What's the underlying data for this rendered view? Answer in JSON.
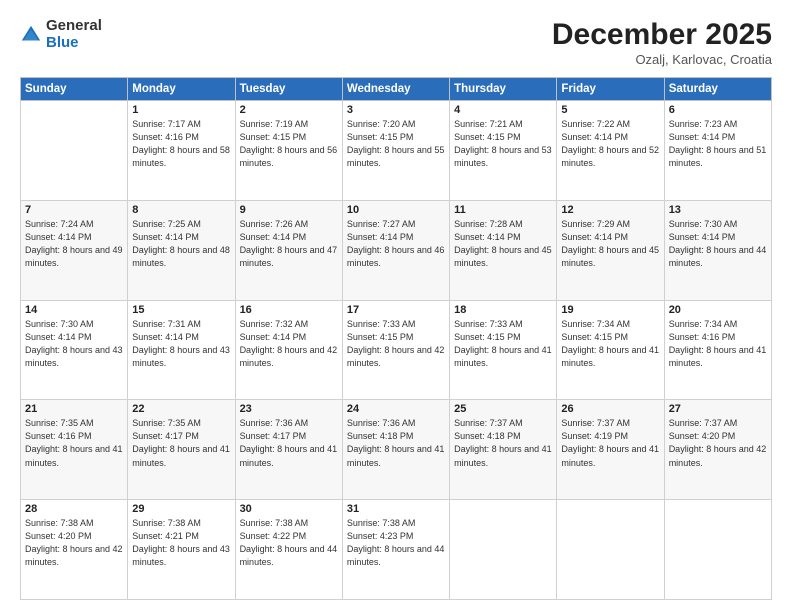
{
  "logo": {
    "general": "General",
    "blue": "Blue"
  },
  "header": {
    "month": "December 2025",
    "location": "Ozalj, Karlovac, Croatia"
  },
  "weekdays": [
    "Sunday",
    "Monday",
    "Tuesday",
    "Wednesday",
    "Thursday",
    "Friday",
    "Saturday"
  ],
  "weeks": [
    [
      {
        "day": "",
        "sunrise": "",
        "sunset": "",
        "daylight": ""
      },
      {
        "day": "1",
        "sunrise": "Sunrise: 7:17 AM",
        "sunset": "Sunset: 4:16 PM",
        "daylight": "Daylight: 8 hours and 58 minutes."
      },
      {
        "day": "2",
        "sunrise": "Sunrise: 7:19 AM",
        "sunset": "Sunset: 4:15 PM",
        "daylight": "Daylight: 8 hours and 56 minutes."
      },
      {
        "day": "3",
        "sunrise": "Sunrise: 7:20 AM",
        "sunset": "Sunset: 4:15 PM",
        "daylight": "Daylight: 8 hours and 55 minutes."
      },
      {
        "day": "4",
        "sunrise": "Sunrise: 7:21 AM",
        "sunset": "Sunset: 4:15 PM",
        "daylight": "Daylight: 8 hours and 53 minutes."
      },
      {
        "day": "5",
        "sunrise": "Sunrise: 7:22 AM",
        "sunset": "Sunset: 4:14 PM",
        "daylight": "Daylight: 8 hours and 52 minutes."
      },
      {
        "day": "6",
        "sunrise": "Sunrise: 7:23 AM",
        "sunset": "Sunset: 4:14 PM",
        "daylight": "Daylight: 8 hours and 51 minutes."
      }
    ],
    [
      {
        "day": "7",
        "sunrise": "Sunrise: 7:24 AM",
        "sunset": "Sunset: 4:14 PM",
        "daylight": "Daylight: 8 hours and 49 minutes."
      },
      {
        "day": "8",
        "sunrise": "Sunrise: 7:25 AM",
        "sunset": "Sunset: 4:14 PM",
        "daylight": "Daylight: 8 hours and 48 minutes."
      },
      {
        "day": "9",
        "sunrise": "Sunrise: 7:26 AM",
        "sunset": "Sunset: 4:14 PM",
        "daylight": "Daylight: 8 hours and 47 minutes."
      },
      {
        "day": "10",
        "sunrise": "Sunrise: 7:27 AM",
        "sunset": "Sunset: 4:14 PM",
        "daylight": "Daylight: 8 hours and 46 minutes."
      },
      {
        "day": "11",
        "sunrise": "Sunrise: 7:28 AM",
        "sunset": "Sunset: 4:14 PM",
        "daylight": "Daylight: 8 hours and 45 minutes."
      },
      {
        "day": "12",
        "sunrise": "Sunrise: 7:29 AM",
        "sunset": "Sunset: 4:14 PM",
        "daylight": "Daylight: 8 hours and 45 minutes."
      },
      {
        "day": "13",
        "sunrise": "Sunrise: 7:30 AM",
        "sunset": "Sunset: 4:14 PM",
        "daylight": "Daylight: 8 hours and 44 minutes."
      }
    ],
    [
      {
        "day": "14",
        "sunrise": "Sunrise: 7:30 AM",
        "sunset": "Sunset: 4:14 PM",
        "daylight": "Daylight: 8 hours and 43 minutes."
      },
      {
        "day": "15",
        "sunrise": "Sunrise: 7:31 AM",
        "sunset": "Sunset: 4:14 PM",
        "daylight": "Daylight: 8 hours and 43 minutes."
      },
      {
        "day": "16",
        "sunrise": "Sunrise: 7:32 AM",
        "sunset": "Sunset: 4:14 PM",
        "daylight": "Daylight: 8 hours and 42 minutes."
      },
      {
        "day": "17",
        "sunrise": "Sunrise: 7:33 AM",
        "sunset": "Sunset: 4:15 PM",
        "daylight": "Daylight: 8 hours and 42 minutes."
      },
      {
        "day": "18",
        "sunrise": "Sunrise: 7:33 AM",
        "sunset": "Sunset: 4:15 PM",
        "daylight": "Daylight: 8 hours and 41 minutes."
      },
      {
        "day": "19",
        "sunrise": "Sunrise: 7:34 AM",
        "sunset": "Sunset: 4:15 PM",
        "daylight": "Daylight: 8 hours and 41 minutes."
      },
      {
        "day": "20",
        "sunrise": "Sunrise: 7:34 AM",
        "sunset": "Sunset: 4:16 PM",
        "daylight": "Daylight: 8 hours and 41 minutes."
      }
    ],
    [
      {
        "day": "21",
        "sunrise": "Sunrise: 7:35 AM",
        "sunset": "Sunset: 4:16 PM",
        "daylight": "Daylight: 8 hours and 41 minutes."
      },
      {
        "day": "22",
        "sunrise": "Sunrise: 7:35 AM",
        "sunset": "Sunset: 4:17 PM",
        "daylight": "Daylight: 8 hours and 41 minutes."
      },
      {
        "day": "23",
        "sunrise": "Sunrise: 7:36 AM",
        "sunset": "Sunset: 4:17 PM",
        "daylight": "Daylight: 8 hours and 41 minutes."
      },
      {
        "day": "24",
        "sunrise": "Sunrise: 7:36 AM",
        "sunset": "Sunset: 4:18 PM",
        "daylight": "Daylight: 8 hours and 41 minutes."
      },
      {
        "day": "25",
        "sunrise": "Sunrise: 7:37 AM",
        "sunset": "Sunset: 4:18 PM",
        "daylight": "Daylight: 8 hours and 41 minutes."
      },
      {
        "day": "26",
        "sunrise": "Sunrise: 7:37 AM",
        "sunset": "Sunset: 4:19 PM",
        "daylight": "Daylight: 8 hours and 41 minutes."
      },
      {
        "day": "27",
        "sunrise": "Sunrise: 7:37 AM",
        "sunset": "Sunset: 4:20 PM",
        "daylight": "Daylight: 8 hours and 42 minutes."
      }
    ],
    [
      {
        "day": "28",
        "sunrise": "Sunrise: 7:38 AM",
        "sunset": "Sunset: 4:20 PM",
        "daylight": "Daylight: 8 hours and 42 minutes."
      },
      {
        "day": "29",
        "sunrise": "Sunrise: 7:38 AM",
        "sunset": "Sunset: 4:21 PM",
        "daylight": "Daylight: 8 hours and 43 minutes."
      },
      {
        "day": "30",
        "sunrise": "Sunrise: 7:38 AM",
        "sunset": "Sunset: 4:22 PM",
        "daylight": "Daylight: 8 hours and 44 minutes."
      },
      {
        "day": "31",
        "sunrise": "Sunrise: 7:38 AM",
        "sunset": "Sunset: 4:23 PM",
        "daylight": "Daylight: 8 hours and 44 minutes."
      },
      {
        "day": "",
        "sunrise": "",
        "sunset": "",
        "daylight": ""
      },
      {
        "day": "",
        "sunrise": "",
        "sunset": "",
        "daylight": ""
      },
      {
        "day": "",
        "sunrise": "",
        "sunset": "",
        "daylight": ""
      }
    ]
  ]
}
